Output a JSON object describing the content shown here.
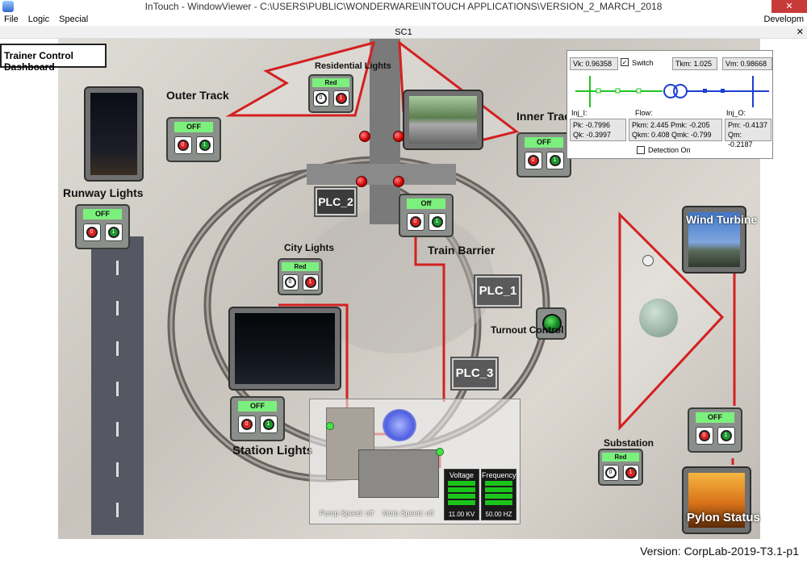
{
  "window": {
    "title": "InTouch - WindowViewer - C:\\USERS\\PUBLIC\\WONDERWARE\\INTOUCH APPLICATIONS\\VERSION_2_MARCH_2018",
    "menu": [
      "File",
      "Logic",
      "Special"
    ],
    "menu_right": "Developm",
    "tab": "SC1"
  },
  "dashboard": {
    "title": "Trainer Control Dashboard",
    "version": "Version: CorpLab-2019-T3.1-p1"
  },
  "controls": {
    "outer_track": {
      "label": "Outer Track",
      "status": "OFF"
    },
    "residential": {
      "label": "Residential Lights",
      "status": "Red"
    },
    "inner_track": {
      "label": "Inner Track",
      "status": "OFF"
    },
    "runway": {
      "label": "Runway Lights",
      "status": "OFF"
    },
    "train_barrier": {
      "label": "Train Barrier",
      "status": "Off"
    },
    "city": {
      "label": "City Lights",
      "status": "Red"
    },
    "station": {
      "label": "Station Lights",
      "status": "OFF"
    },
    "wind": {
      "label": "Wind Turbine"
    },
    "turbine_ctrl": {
      "status": "OFF"
    },
    "substation": {
      "label": "Substation",
      "status": "Red"
    },
    "pylon": {
      "label": "Pylon Status"
    },
    "turnout": {
      "label": "Turnout Control"
    },
    "btn_off_glyph": "0",
    "btn_on_glyph": "1"
  },
  "plc": {
    "plc1": "PLC_1",
    "plc2": "PLC_2",
    "plc3": "PLC_3"
  },
  "power_panel": {
    "vk": "Vk: 0.96358",
    "switch_label": "Switch",
    "tkm": "Tkm: 1.025",
    "vm": "Vm: 0.98668",
    "inj_i": "Inj_I:",
    "flow": "Flow:",
    "inj_o": "Inj_O:",
    "pk": "Pk: -0.7996",
    "qk": "Qk: -0.3997",
    "pkm": "Pkm: 2.445 Pmk: -0.205",
    "qkm": "Qkm: 0.408 Qmk: -0.799",
    "pm": "Pm: -0.4137",
    "qm": "Qm: -0.2187",
    "detection": "Detection On"
  },
  "generator": {
    "voltage_label": "Voltage",
    "frequency_label": "Frequency",
    "voltage_value": "11.00 KV",
    "frequency_value": "50.00 HZ",
    "pump_speed": "Pump Speed: off",
    "moto_speed": "Moto Speed: off"
  },
  "colors": {
    "status_green": "#7cf07c",
    "alarm_red": "#d42020"
  }
}
